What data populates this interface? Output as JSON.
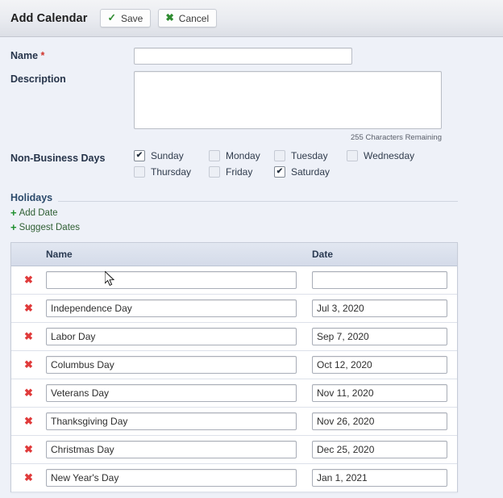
{
  "header": {
    "title": "Add Calendar",
    "save_label": "Save",
    "save_icon": "check-icon",
    "cancel_label": "Cancel",
    "cancel_icon": "x-icon"
  },
  "form": {
    "name_label": "Name",
    "name_required_mark": "*",
    "name_value": "",
    "description_label": "Description",
    "description_value": "",
    "char_remaining": "255 Characters Remaining",
    "non_business_label": "Non-Business Days",
    "days": [
      {
        "label": "Sunday",
        "checked": true,
        "mark": "✔"
      },
      {
        "label": "Monday",
        "checked": false,
        "mark": ""
      },
      {
        "label": "Tuesday",
        "checked": false,
        "mark": ""
      },
      {
        "label": "Wednesday",
        "checked": false,
        "mark": ""
      },
      {
        "label": "Thursday",
        "checked": false,
        "mark": ""
      },
      {
        "label": "Friday",
        "checked": false,
        "mark": ""
      },
      {
        "label": "Saturday",
        "checked": true,
        "mark": "✔"
      }
    ]
  },
  "holidays": {
    "section_title": "Holidays",
    "add_date_label": "Add Date",
    "suggest_dates_label": "Suggest Dates",
    "plus_glyph": "+",
    "columns": {
      "name": "Name",
      "date": "Date"
    },
    "delete_glyph": "✖",
    "rows": [
      {
        "name": "",
        "date": ""
      },
      {
        "name": "Independence Day",
        "date": "Jul 3, 2020"
      },
      {
        "name": "Labor Day",
        "date": "Sep 7, 2020"
      },
      {
        "name": "Columbus Day",
        "date": "Oct 12, 2020"
      },
      {
        "name": "Veterans Day",
        "date": "Nov 11, 2020"
      },
      {
        "name": "Thanksgiving Day",
        "date": "Nov 26, 2020"
      },
      {
        "name": "Christmas Day",
        "date": "Dec 25, 2020"
      },
      {
        "name": "New Year's Day",
        "date": "Jan 1, 2021"
      }
    ]
  },
  "colors": {
    "page_bg": "#eef1f8",
    "accent_green": "#2e8b30",
    "delete_red": "#e03b3b",
    "required_red": "#d0342c",
    "section_blue": "#2b4a6b",
    "header_row": "#d4dbe9"
  }
}
